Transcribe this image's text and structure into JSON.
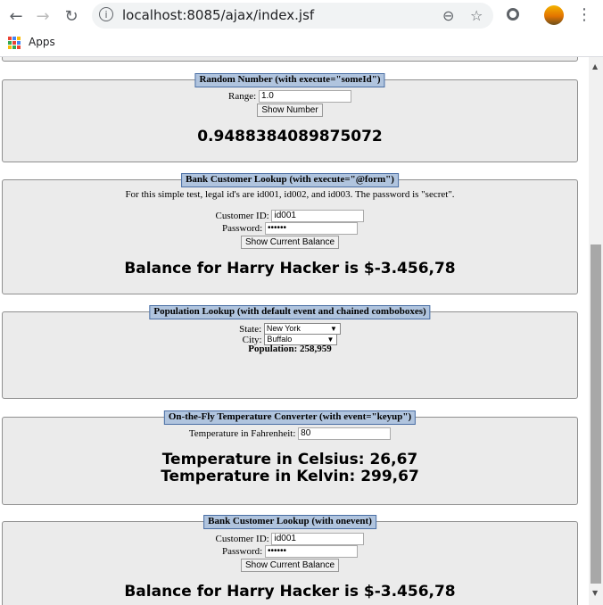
{
  "browser": {
    "url": "localhost:8085/ajax/index.jsf",
    "bookmarks_label": "Apps"
  },
  "sections": {
    "random": {
      "legend": "Random Number (with execute=\"someId\")",
      "range_label": "Range:",
      "range_value": "1.0",
      "button_label": "Show Number",
      "result": "0.9488384089875072"
    },
    "bank_form": {
      "legend": "Bank Customer Lookup (with execute=\"@form\")",
      "note": "For this simple test, legal id's are id001, id002, and id003. The password is \"secret\".",
      "customer_id_label": "Customer ID:",
      "customer_id_value": "id001",
      "password_label": "Password:",
      "password_value": "••••••",
      "button_label": "Show Current Balance",
      "result": "Balance for Harry Hacker is $-3.456,78"
    },
    "population": {
      "legend": "Population Lookup (with default event and chained comboboxes)",
      "state_label": "State:",
      "state_value": "New York",
      "city_label": "City:",
      "city_value": "Buffalo",
      "population_text": "Population: 258,959"
    },
    "temperature": {
      "legend": "On-the-Fly Temperature Converter (with event=\"keyup\")",
      "input_label": "Temperature in Fahrenheit:",
      "input_value": "80",
      "celsius": "Temperature in Celsius: 26,67",
      "kelvin": "Temperature in Kelvin: 299,67"
    },
    "bank_onevent": {
      "legend": "Bank Customer Lookup (with onevent)",
      "customer_id_label": "Customer ID:",
      "customer_id_value": "id001",
      "password_label": "Password:",
      "password_value": "••••••",
      "button_label": "Show Current Balance",
      "result": "Balance for Harry Hacker is $-3.456,78"
    }
  },
  "colors": {
    "legend_bg": "#b0c4de",
    "fieldset_bg": "#ebebeb"
  }
}
